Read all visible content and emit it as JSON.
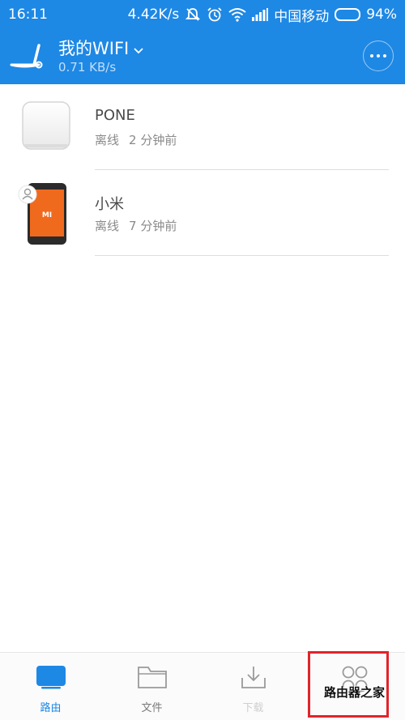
{
  "status_bar": {
    "time": "16:11",
    "speed": "4.42K/s",
    "carrier": "中国移动",
    "battery": "94%",
    "battery_level": 0.94,
    "icons": [
      "mute-icon",
      "alarm-icon",
      "wifi-icon",
      "signal-icon",
      "battery-icon"
    ]
  },
  "header": {
    "title": "我的WIFI",
    "subtitle": "0.71 KB/s",
    "icons": [
      "router-logo-icon",
      "chevron-down-icon",
      "more-icon"
    ]
  },
  "devices": [
    {
      "name": "PONE",
      "state": "离线",
      "time": "2 分钟前",
      "icon": "device-generic-icon"
    },
    {
      "name": "小米",
      "state": "离线",
      "time": "7 分钟前",
      "icon": "phone-mi-icon",
      "badge_icon": "user-icon"
    }
  ],
  "phone_brand_text": "MI",
  "bottom_nav": [
    {
      "label": "路由",
      "icon": "router-icon",
      "active": true
    },
    {
      "label": "文件",
      "icon": "folder-icon",
      "active": false
    },
    {
      "label": "下载",
      "icon": "download-icon",
      "active": false
    },
    {
      "label": "",
      "icon": "circles-icon",
      "active": false
    }
  ],
  "watermark": {
    "text": "路由器之家",
    "sub": ""
  },
  "colors": {
    "primary": "#1e88e5",
    "highlight": "#e2232a",
    "phone": "#f06a1e"
  }
}
